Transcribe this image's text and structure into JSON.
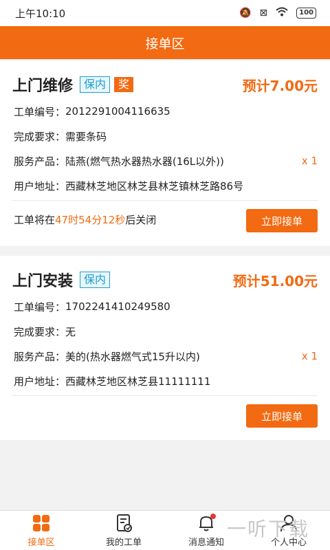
{
  "status_bar": {
    "time": "上午10:10",
    "battery": "100"
  },
  "header": {
    "title": "接单区"
  },
  "orders": [
    {
      "title": "上门维修",
      "tags": [
        "保内",
        "奖"
      ],
      "price": "预计7.00元",
      "order_no_label": "工单编号：",
      "order_no": "2012291004116635",
      "requirement_label": "完成要求：",
      "requirement": "需要条码",
      "product_label": "服务产品：",
      "product": "陆燕(燃气热水器热水器(16L以外))",
      "qty": "x 1",
      "address_label": "用户地址：",
      "address": "西藏林芝地区林芝县林芝镇林芝路86号",
      "close_prefix": "工单将在",
      "countdown": "47时54分12秒",
      "close_suffix": "后关闭",
      "button": "立即接单"
    },
    {
      "title": "上门安装",
      "tags": [
        "保内"
      ],
      "price": "预计51.00元",
      "order_no_label": "工单编号：",
      "order_no": "1702241410249580",
      "requirement_label": "完成要求：",
      "requirement": "无",
      "product_label": "服务产品：",
      "product": "美的(热水器燃气式15升以内)",
      "qty": "x 1",
      "address_label": "用户地址：",
      "address": "西藏林芝地区林芝县11111111",
      "button": "立即接单"
    }
  ],
  "bottom_nav": [
    {
      "label": "接单区",
      "icon": "grid-icon",
      "active": true
    },
    {
      "label": "我的工单",
      "icon": "document-icon",
      "active": false
    },
    {
      "label": "消息通知",
      "icon": "bell-icon",
      "active": false
    },
    {
      "label": "个人中心",
      "icon": "user-icon",
      "active": false
    }
  ],
  "watermark": "一听下载",
  "colors": {
    "accent": "#f26a12",
    "tag_blue": "#1a9fd0"
  }
}
